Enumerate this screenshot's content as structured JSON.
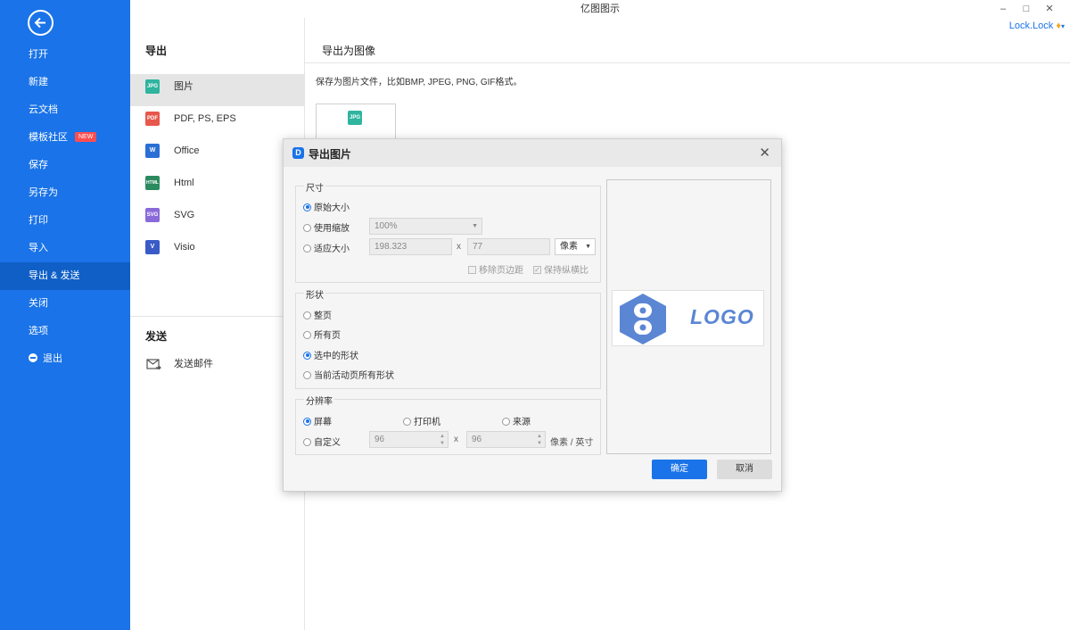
{
  "app": {
    "title": "亿图图示",
    "user": "Lock.Lock",
    "controls": [
      "–",
      "□",
      "✕"
    ]
  },
  "sidebar": {
    "items": [
      {
        "label": "打开"
      },
      {
        "label": "新建"
      },
      {
        "label": "云文档"
      },
      {
        "label": "模板社区",
        "badge": "NEW"
      },
      {
        "label": "保存"
      },
      {
        "label": "另存为"
      },
      {
        "label": "打印"
      },
      {
        "label": "导入"
      },
      {
        "label": "导出 & 发送",
        "active": true
      },
      {
        "label": "关闭"
      },
      {
        "label": "选项"
      },
      {
        "label": "退出"
      }
    ]
  },
  "export": {
    "section_title": "导出",
    "items": [
      {
        "label": "图片",
        "icon": "JPG"
      },
      {
        "label": "PDF, PS, EPS",
        "icon": "PDF"
      },
      {
        "label": "Office",
        "icon": "W"
      },
      {
        "label": "Html",
        "icon": "HTML"
      },
      {
        "label": "SVG",
        "icon": "SVG"
      },
      {
        "label": "Visio",
        "icon": "V"
      }
    ],
    "send_title": "发送",
    "send_item": "发送邮件"
  },
  "main": {
    "title": "导出为图像",
    "description": "保存为图片文件，比如BMP, JPEG, PNG, GIF格式。",
    "thumb_icon": "JPG"
  },
  "dialog": {
    "title": "导出图片",
    "size": {
      "label": "尺寸",
      "original": "原始大小",
      "zoom": "使用缩放",
      "zoom_value": "100%",
      "fit": "适应大小",
      "width": "198.323",
      "height": "77",
      "x": "x",
      "unit": "像素",
      "remove_margin": "移除页边距",
      "keep_ratio": "保持纵横比"
    },
    "shape": {
      "label": "形状",
      "options": [
        "整页",
        "所有页",
        "选中的形状",
        "当前活动页所有形状"
      ]
    },
    "resolution": {
      "label": "分辨率",
      "screen": "屏幕",
      "printer": "打印机",
      "source": "来源",
      "custom": "自定义",
      "dpi_x": "96",
      "dpi_y": "96",
      "x": "x",
      "unit": "像素 / 英寸"
    },
    "preview_logo_text": "LOGO",
    "ok": "确定",
    "cancel": "取消",
    "close": "✕"
  }
}
